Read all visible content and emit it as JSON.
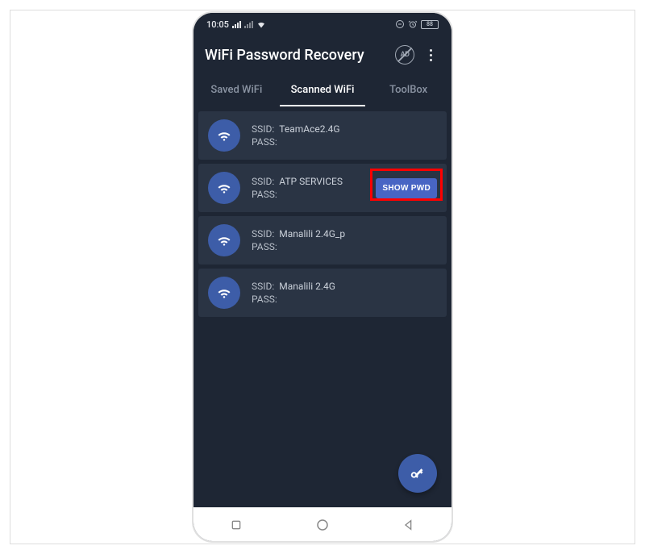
{
  "statusbar": {
    "time": "10:05",
    "battery": "88"
  },
  "header": {
    "title": "WiFi Password Recovery",
    "ad_label": "AD"
  },
  "tabs": [
    {
      "label": "Saved WiFi",
      "active": false
    },
    {
      "label": "Scanned WiFi",
      "active": true
    },
    {
      "label": "ToolBox",
      "active": false
    }
  ],
  "labels": {
    "ssid": "SSID:",
    "pass": "PASS:",
    "show_pwd": "SHOW PWD"
  },
  "networks": [
    {
      "ssid": "TeamAce2.4G",
      "pass": "",
      "highlighted": false
    },
    {
      "ssid": "ATP SERVICES",
      "pass": "",
      "highlighted": true
    },
    {
      "ssid": "Manalili 2.4G_p",
      "pass": "",
      "highlighted": false
    },
    {
      "ssid": "Manalili 2.4G",
      "pass": "",
      "highlighted": false
    }
  ]
}
